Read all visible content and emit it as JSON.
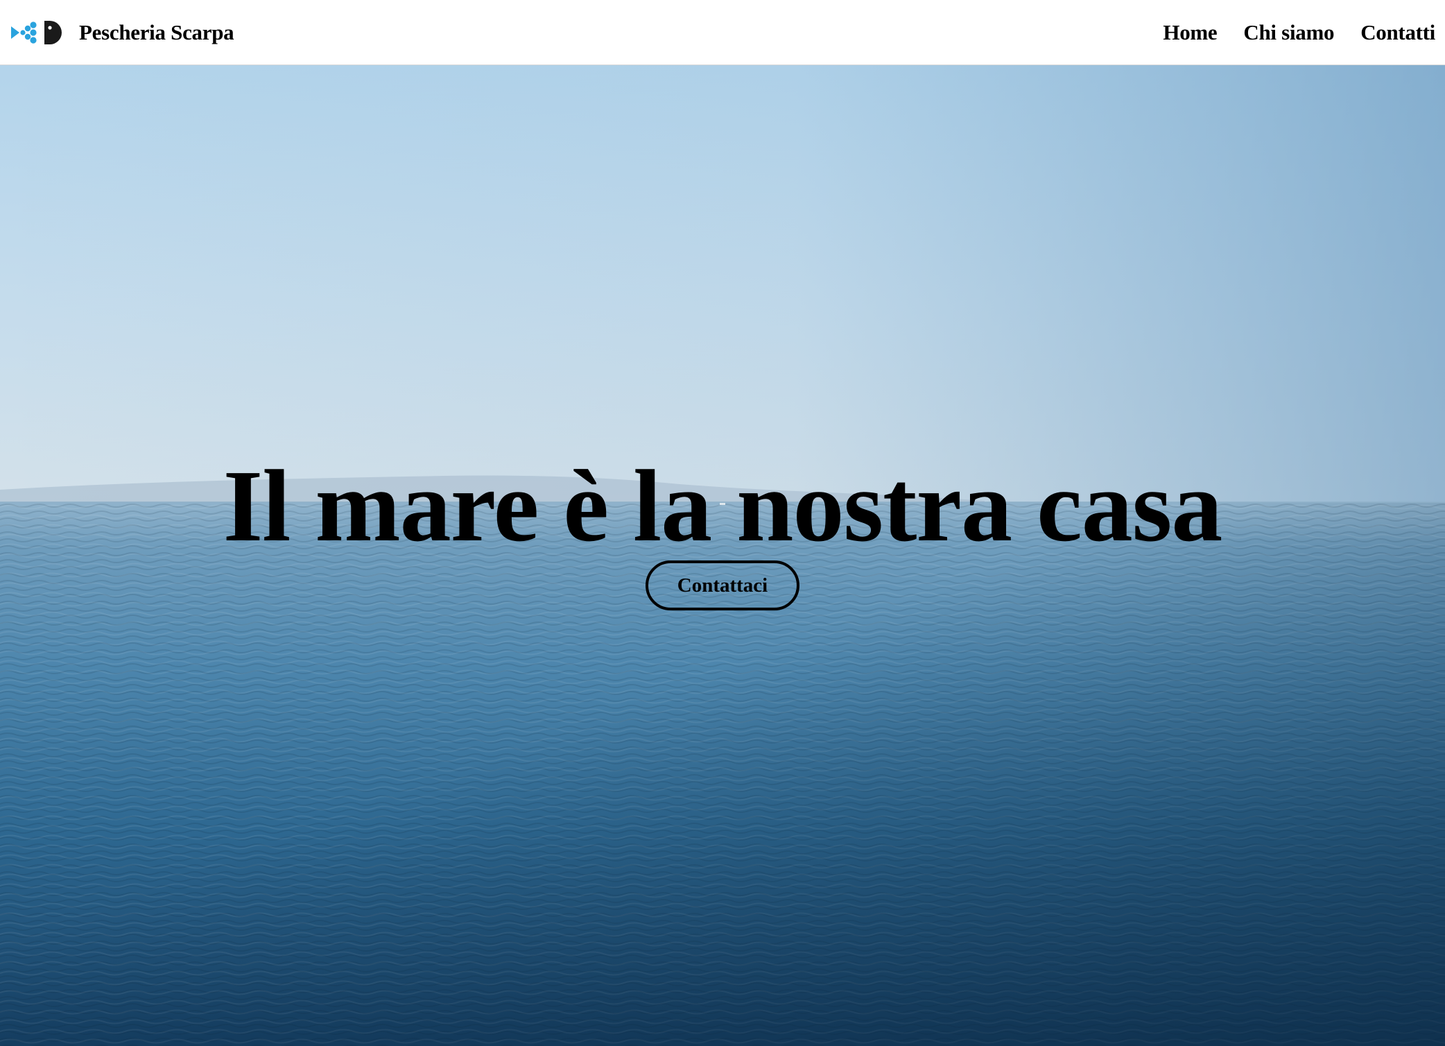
{
  "header": {
    "brand_name": "Pescheria Scarpa",
    "logo_icon": "fish-logo-icon",
    "nav": [
      {
        "label": "Home"
      },
      {
        "label": "Chi siamo"
      },
      {
        "label": "Contatti"
      }
    ]
  },
  "hero": {
    "title": "Il mare è la nostra casa",
    "cta_label": "Contattaci",
    "background": "sea-horizon-photo"
  },
  "colors": {
    "logo_blue": "#2aa3de",
    "logo_dark": "#1a1a1a",
    "sky_top": "#b6d6ec",
    "horizon": "#cfdfea",
    "sea_mid": "#3f7ea6",
    "sea_deep": "#123a5a"
  }
}
